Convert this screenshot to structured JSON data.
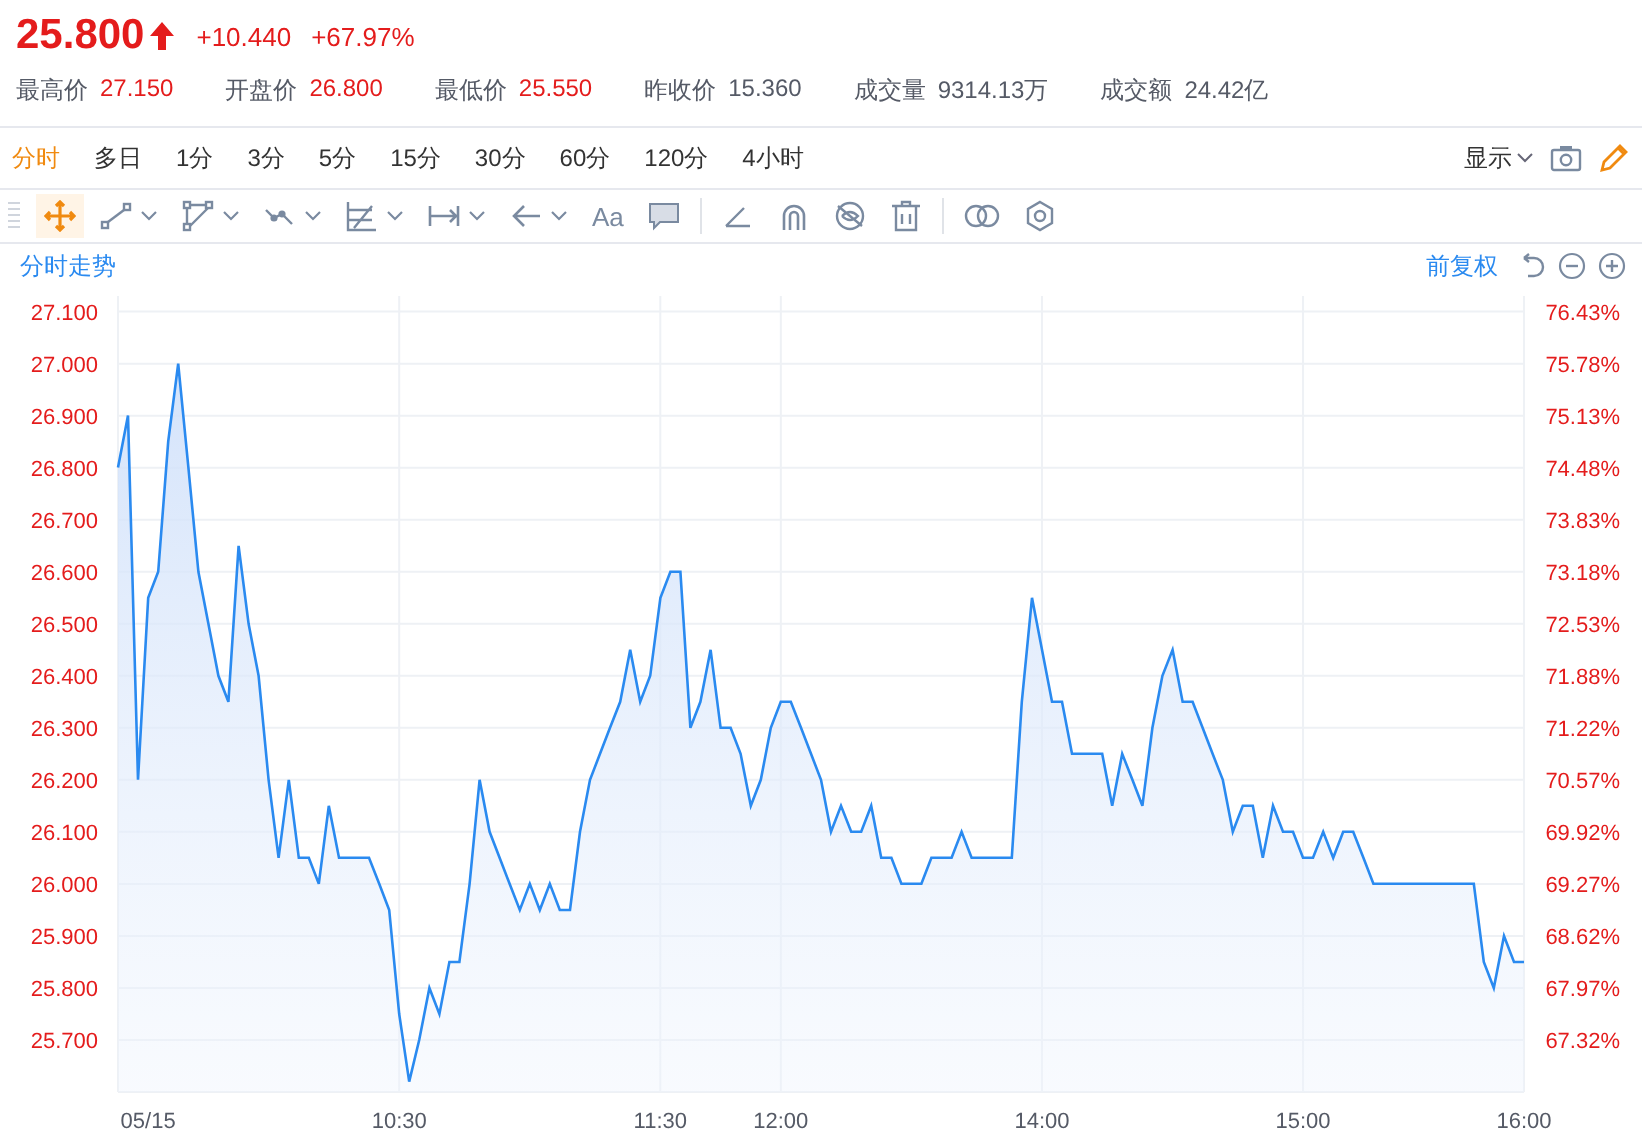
{
  "quote": {
    "price": "25.800",
    "change": "+10.440",
    "change_pct": "+67.97%"
  },
  "stats": [
    {
      "label": "最高价",
      "value": "27.150",
      "color": "#e41c1c"
    },
    {
      "label": "开盘价",
      "value": "26.800",
      "color": "#e41c1c"
    },
    {
      "label": "最低价",
      "value": "25.550",
      "color": "#e41c1c"
    },
    {
      "label": "昨收价",
      "value": "15.360",
      "color": "#555a66"
    },
    {
      "label": "成交量",
      "value": "9314.13万",
      "color": "#555a66"
    },
    {
      "label": "成交额",
      "value": "24.42亿",
      "color": "#555a66"
    }
  ],
  "period_tabs": [
    {
      "label": "分时",
      "selected": true
    },
    {
      "label": "多日",
      "selected": false
    },
    {
      "label": "1分",
      "selected": false
    },
    {
      "label": "3分",
      "selected": false
    },
    {
      "label": "5分",
      "selected": false
    },
    {
      "label": "15分",
      "selected": false
    },
    {
      "label": "30分",
      "selected": false
    },
    {
      "label": "60分",
      "selected": false
    },
    {
      "label": "120分",
      "selected": false
    },
    {
      "label": "4小时",
      "selected": false
    }
  ],
  "display_menu": {
    "label": "显示"
  },
  "toolbar": [
    {
      "kind": "move",
      "selected": true,
      "dropdown": false
    },
    {
      "kind": "segment",
      "selected": false,
      "dropdown": true
    },
    {
      "kind": "polygon",
      "selected": false,
      "dropdown": true
    },
    {
      "kind": "wave",
      "selected": false,
      "dropdown": true
    },
    {
      "kind": "fib",
      "selected": false,
      "dropdown": true
    },
    {
      "kind": "range",
      "selected": false,
      "dropdown": true
    },
    {
      "kind": "arrow",
      "selected": false,
      "dropdown": true
    },
    {
      "kind": "text",
      "label": "Aa",
      "selected": false,
      "dropdown": false
    },
    {
      "kind": "note",
      "selected": false,
      "dropdown": false
    },
    {
      "kind": "sep"
    },
    {
      "kind": "angle",
      "selected": false,
      "dropdown": false
    },
    {
      "kind": "magnet",
      "selected": false,
      "dropdown": false
    },
    {
      "kind": "hide",
      "selected": false,
      "dropdown": false
    },
    {
      "kind": "trash",
      "selected": false,
      "dropdown": false
    },
    {
      "kind": "sep"
    },
    {
      "kind": "compare",
      "selected": false,
      "dropdown": false
    },
    {
      "kind": "settings",
      "selected": false,
      "dropdown": false
    }
  ],
  "chart_panel": {
    "title": "分时走势",
    "adjust": "前复权",
    "right_axis_labels": [
      "76.43%",
      "75.78%",
      "75.13%",
      "74.48%",
      "73.83%",
      "73.18%",
      "72.53%",
      "71.88%",
      "71.22%",
      "70.57%",
      "69.92%",
      "69.27%",
      "68.62%",
      "67.97%",
      "67.32%"
    ],
    "chart_data": {
      "type": "area",
      "grid": true,
      "ylim": [
        25.6,
        27.13
      ],
      "yticks": [
        {
          "value": 27.1,
          "label": "27.100"
        },
        {
          "value": 27.0,
          "label": "27.000"
        },
        {
          "value": 26.9,
          "label": "26.900"
        },
        {
          "value": 26.8,
          "label": "26.800"
        },
        {
          "value": 26.7,
          "label": "26.700"
        },
        {
          "value": 26.6,
          "label": "26.600"
        },
        {
          "value": 26.5,
          "label": "26.500"
        },
        {
          "value": 26.4,
          "label": "26.400"
        },
        {
          "value": 26.3,
          "label": "26.300"
        },
        {
          "value": 26.2,
          "label": "26.200"
        },
        {
          "value": 26.1,
          "label": "26.100"
        },
        {
          "value": 26.0,
          "label": "26.000"
        },
        {
          "value": 25.9,
          "label": "25.900"
        },
        {
          "value": 25.8,
          "label": "25.800"
        },
        {
          "value": 25.7,
          "label": "25.700"
        }
      ],
      "categories": [
        null,
        null,
        null,
        "05/15",
        null,
        null,
        null,
        null,
        null,
        null,
        null,
        null,
        null,
        null,
        null,
        null,
        null,
        null,
        null,
        null,
        null,
        null,
        null,
        null,
        null,
        null,
        null,
        null,
        "10:30",
        null,
        null,
        null,
        null,
        null,
        null,
        null,
        null,
        null,
        null,
        null,
        null,
        null,
        null,
        null,
        null,
        null,
        null,
        null,
        null,
        null,
        null,
        null,
        null,
        null,
        "11:30",
        null,
        null,
        null,
        null,
        null,
        null,
        null,
        null,
        null,
        null,
        null,
        "12:00",
        null,
        null,
        null,
        null,
        null,
        null,
        null,
        null,
        null,
        null,
        null,
        null,
        null,
        null,
        null,
        null,
        null,
        null,
        null,
        null,
        null,
        null,
        null,
        null,
        null,
        "14:00",
        null,
        null,
        null,
        null,
        null,
        null,
        null,
        null,
        null,
        null,
        null,
        null,
        null,
        null,
        null,
        null,
        null,
        null,
        null,
        null,
        null,
        null,
        null,
        null,
        null,
        "15:00",
        null,
        null,
        null,
        null,
        null,
        null,
        null,
        null,
        null,
        null,
        null,
        null,
        null,
        null,
        null,
        null,
        null,
        null,
        null,
        null,
        null,
        "16:00"
      ],
      "series": [
        {
          "color": "#2a8af0",
          "values": [
            26.8,
            26.9,
            26.2,
            26.55,
            26.6,
            26.85,
            27.0,
            26.8,
            26.6,
            26.5,
            26.4,
            26.35,
            26.65,
            26.5,
            26.4,
            26.2,
            26.05,
            26.2,
            26.05,
            26.05,
            26.0,
            26.15,
            26.05,
            26.05,
            26.05,
            26.05,
            26.0,
            25.95,
            25.75,
            25.62,
            25.7,
            25.8,
            25.75,
            25.85,
            25.85,
            26.0,
            26.2,
            26.1,
            26.05,
            26.0,
            25.95,
            26.0,
            25.95,
            26.0,
            25.95,
            25.95,
            26.1,
            26.2,
            26.25,
            26.3,
            26.35,
            26.45,
            26.35,
            26.4,
            26.55,
            26.6,
            26.6,
            26.3,
            26.35,
            26.45,
            26.3,
            26.3,
            26.25,
            26.15,
            26.2,
            26.3,
            26.35,
            26.35,
            26.3,
            26.25,
            26.2,
            26.1,
            26.15,
            26.1,
            26.1,
            26.15,
            26.05,
            26.05,
            26.0,
            26.0,
            26.0,
            26.05,
            26.05,
            26.05,
            26.1,
            26.05,
            26.05,
            26.05,
            26.05,
            26.05,
            26.35,
            26.55,
            26.45,
            26.35,
            26.35,
            26.25,
            26.25,
            26.25,
            26.25,
            26.15,
            26.25,
            26.2,
            26.15,
            26.3,
            26.4,
            26.45,
            26.35,
            26.35,
            26.3,
            26.25,
            26.2,
            26.1,
            26.15,
            26.15,
            26.05,
            26.15,
            26.1,
            26.1,
            26.05,
            26.05,
            26.1,
            26.05,
            26.1,
            26.1,
            26.05,
            26.0,
            26.0,
            26.0,
            26.0,
            26.0,
            26.0,
            26.0,
            26.0,
            26.0,
            26.0,
            26.0,
            25.85,
            25.8,
            25.9,
            25.85,
            25.85
          ]
        }
      ]
    }
  }
}
